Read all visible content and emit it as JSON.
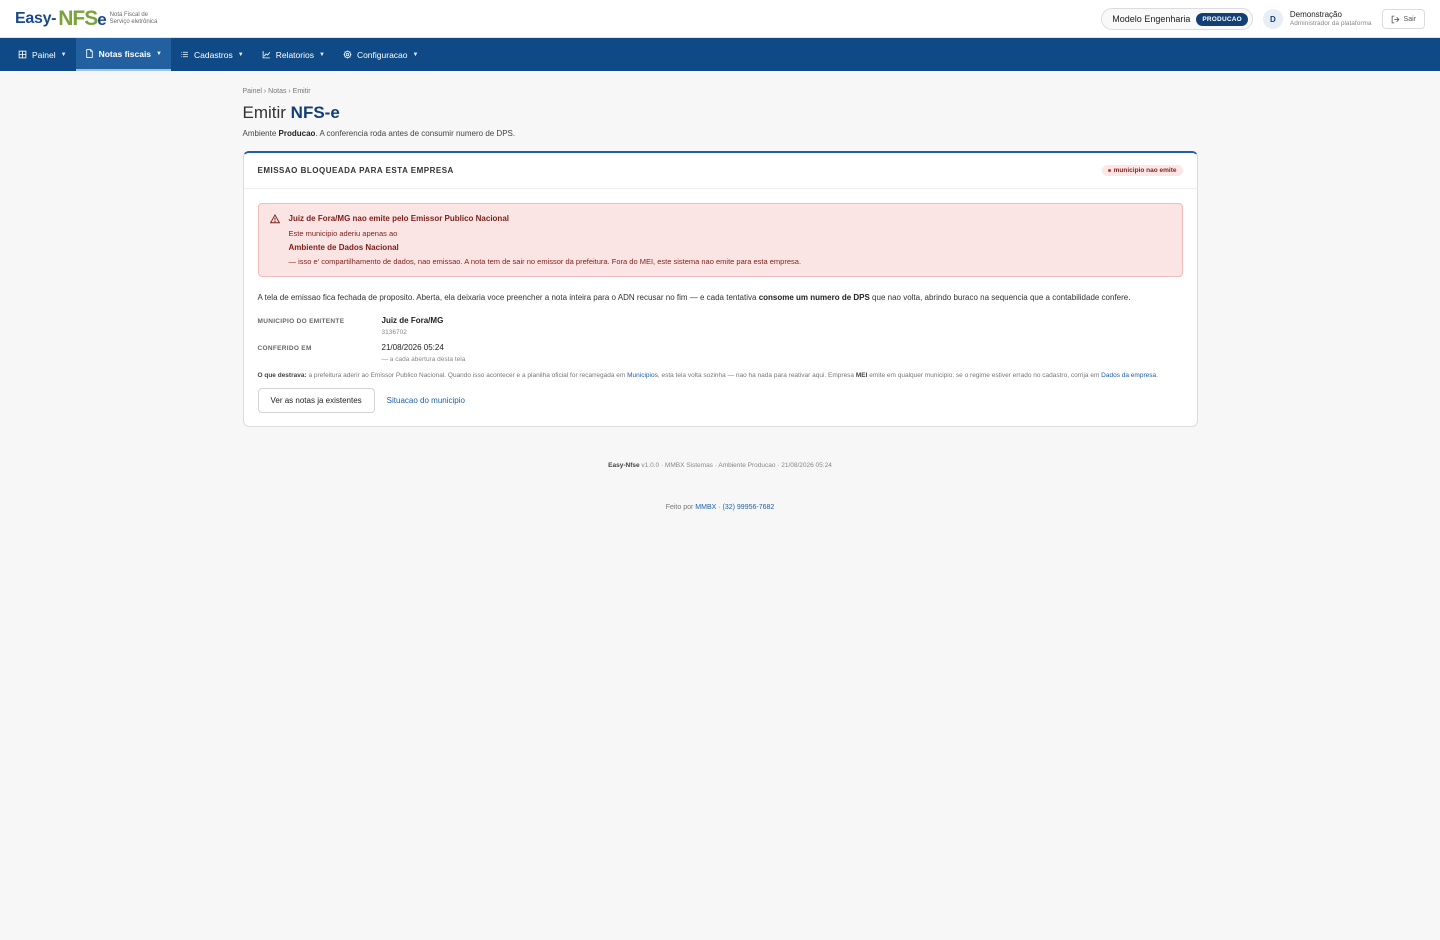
{
  "brand": {
    "logo_easy": "Easy-",
    "logo_nfs": "NFS",
    "logo_e": "e",
    "logo_sub": "Nota Fiscal de Serviço eletrônica"
  },
  "header": {
    "company": "Modelo Engenharia",
    "env_badge": "PRODUCAO",
    "avatar_letter": "D",
    "user_name": "Demonstração",
    "user_role": "Administrador da plataforma",
    "logout_label": "Sair"
  },
  "nav": {
    "items": [
      {
        "label": "Painel",
        "icon": "grid-icon"
      },
      {
        "label": "Notas fiscais",
        "icon": "document-icon"
      },
      {
        "label": "Cadastros",
        "icon": "list-icon"
      },
      {
        "label": "Relatorios",
        "icon": "chart-icon"
      },
      {
        "label": "Configuracao",
        "icon": "gear-icon"
      }
    ]
  },
  "main": {
    "breadcrumb": "Painel › Notas › Emitir",
    "title_prefix": "Emitir ",
    "title_strong": "NFS-e",
    "subtitle_prefix": "Ambiente ",
    "subtitle_env": "Producao",
    "subtitle_suffix": ". A conferencia roda antes de consumir numero de DPS."
  },
  "card": {
    "title": "EMISSAO BLOQUEADA PARA ESTA EMPRESA",
    "status_badge": "municipio nao emite",
    "alert": {
      "title": "Juiz de Fora/MG nao emite pelo Emissor Publico Nacional",
      "line1": "Este municipio aderiu apenas ao",
      "strong": "Ambiente de Dados Nacional",
      "line2": "— isso e' compartilhamento de dados, nao emissao. A nota tem de sair no emissor da prefeitura. Fora do MEI, este sistema nao emite para esta empresa."
    },
    "paragraph_a": "A tela de emissao fica fechada de proposito. Aberta, ela deixaria voce preencher a nota inteira para o ADN recusar no fim — e cada tentativa ",
    "paragraph_b": "consome um numero de DPS",
    "paragraph_c": " que nao volta, abrindo buraco na sequencia que a contabilidade confere.",
    "municipio_label": "MUNICIPIO DO EMITENTE",
    "municipio_value": "Juiz de Fora/MG",
    "municipio_code": "3136702",
    "conferido_label": "CONFERIDO EM",
    "conferido_value": "21/08/2026 05:24",
    "conferido_sub": "— a cada abertura desta tela",
    "hint_label": "O que destrava:",
    "hint_a": " a prefeitura aderir ao Emissor Publico Nacional. Quando isso acontecer e a planilha oficial for recarregada em ",
    "hint_link1": "Municipios",
    "hint_b": ", esta tela volta sozinha — nao ha nada para reativar aqui. Empresa ",
    "hint_mei": "MEI",
    "hint_c": " emite em qualquer municipio: se o regime estiver errado no cadastro, corrija em ",
    "hint_link2": "Dados da empresa",
    "hint_d": ".",
    "btn_notas": "Ver as notas ja existentes",
    "link_situacao": "Situacao do municipio"
  },
  "footer": {
    "app": "Easy-Nfse",
    "rest": " v1.0.0 · MMBX Sistemas · Ambiente Producao · 21/08/2026 05:24",
    "made_by": "Feito por ",
    "vendor": "MMBX",
    "sep": " · ",
    "phone": "(32) 99956-7682"
  }
}
